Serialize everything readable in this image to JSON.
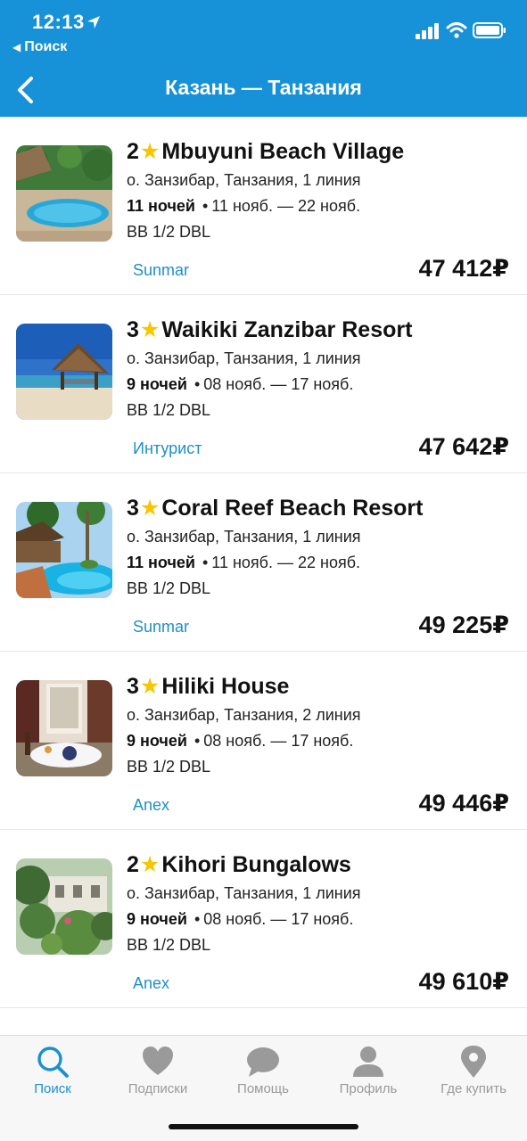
{
  "status_bar": {
    "time": "12:13",
    "back_app_label": "Поиск"
  },
  "header": {
    "title": "Казань — Танзания",
    "back_icon": "chevron-left-icon"
  },
  "colors": {
    "header_bg": "#1791d7",
    "star": "#f7c600",
    "operator": "#1f8fc9",
    "tab_active": "#1a8fd4",
    "tab_inactive": "#9a9a9a"
  },
  "hotels": [
    {
      "stars": "2",
      "star_glyph": "★",
      "name": "Mbuyuni Beach Village",
      "location": "о. Занзибар, Танзания, 1 линия",
      "nights": "11 ночей",
      "dot": "•",
      "dates": "11 нояб. — 22 нояб.",
      "room": "BB 1/2 DBL",
      "operator": "Sunmar",
      "price": "47 412₽"
    },
    {
      "stars": "3",
      "star_glyph": "★",
      "name": "Waikiki Zanzibar Resort",
      "location": "о. Занзибар, Танзания, 1 линия",
      "nights": "9 ночей",
      "dot": "•",
      "dates": "08 нояб. — 17 нояб.",
      "room": "BB 1/2 DBL",
      "operator": "Интурист",
      "price": "47 642₽"
    },
    {
      "stars": "3",
      "star_glyph": "★",
      "name": "Coral Reef Beach Resort",
      "location": "о. Занзибар, Танзания, 1 линия",
      "nights": "11 ночей",
      "dot": "•",
      "dates": "11 нояб. — 22 нояб.",
      "room": "BB 1/2 DBL",
      "operator": "Sunmar",
      "price": "49 225₽"
    },
    {
      "stars": "3",
      "star_glyph": "★",
      "name": "Hiliki House",
      "location": "о. Занзибар, Танзания, 2 линия",
      "nights": "9 ночей",
      "dot": "•",
      "dates": "08 нояб. — 17 нояб.",
      "room": "BB 1/2 DBL",
      "operator": "Anex",
      "price": "49 446₽"
    },
    {
      "stars": "2",
      "star_glyph": "★",
      "name": "Kihori Bungalows",
      "location": "о. Занзибар, Танзания, 1 линия",
      "nights": "9 ночей",
      "dot": "•",
      "dates": "08 нояб. — 17 нояб.",
      "room": "BB 1/2 DBL",
      "operator": "Anex",
      "price": "49 610₽"
    }
  ],
  "tabbar": {
    "tabs": [
      {
        "label": "Поиск",
        "icon": "search-icon",
        "active": true
      },
      {
        "label": "Подписки",
        "icon": "heart-icon",
        "active": false
      },
      {
        "label": "Помощь",
        "icon": "chat-bubble-icon",
        "active": false
      },
      {
        "label": "Профиль",
        "icon": "person-icon",
        "active": false
      },
      {
        "label": "Где купить",
        "icon": "map-pin-icon",
        "active": false
      }
    ]
  }
}
